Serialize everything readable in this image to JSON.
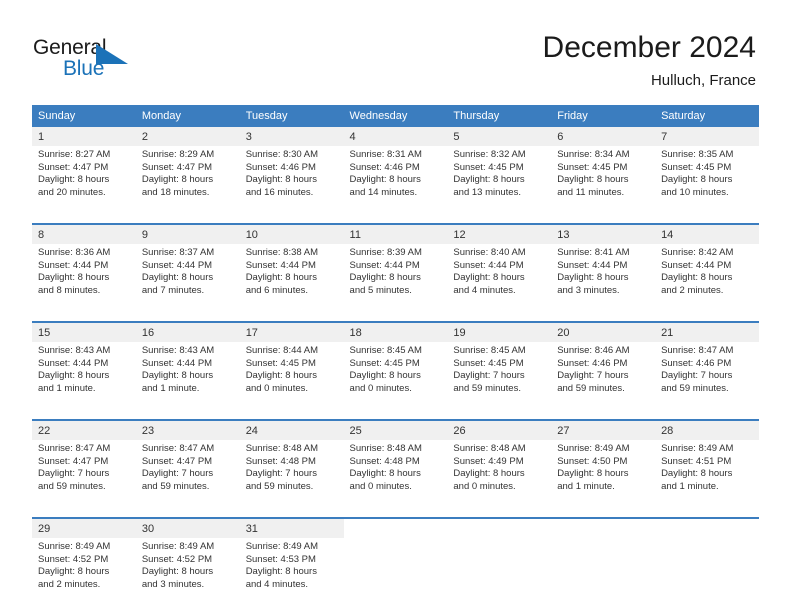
{
  "brand": {
    "name_part1": "General",
    "name_part2": "Blue",
    "accent_color": "#1b72b8"
  },
  "header": {
    "title": "December 2024",
    "subtitle": "Hulluch, France"
  },
  "theme": {
    "header_bg": "#3b7dbf",
    "daynum_bg": "#f0f0f0",
    "text": "#333333"
  },
  "weekdays": [
    "Sunday",
    "Monday",
    "Tuesday",
    "Wednesday",
    "Thursday",
    "Friday",
    "Saturday"
  ],
  "weeks": [
    [
      {
        "day": "1",
        "sunrise": "Sunrise: 8:27 AM",
        "sunset": "Sunset: 4:47 PM",
        "daylight1": "Daylight: 8 hours",
        "daylight2": "and 20 minutes."
      },
      {
        "day": "2",
        "sunrise": "Sunrise: 8:29 AM",
        "sunset": "Sunset: 4:47 PM",
        "daylight1": "Daylight: 8 hours",
        "daylight2": "and 18 minutes."
      },
      {
        "day": "3",
        "sunrise": "Sunrise: 8:30 AM",
        "sunset": "Sunset: 4:46 PM",
        "daylight1": "Daylight: 8 hours",
        "daylight2": "and 16 minutes."
      },
      {
        "day": "4",
        "sunrise": "Sunrise: 8:31 AM",
        "sunset": "Sunset: 4:46 PM",
        "daylight1": "Daylight: 8 hours",
        "daylight2": "and 14 minutes."
      },
      {
        "day": "5",
        "sunrise": "Sunrise: 8:32 AM",
        "sunset": "Sunset: 4:45 PM",
        "daylight1": "Daylight: 8 hours",
        "daylight2": "and 13 minutes."
      },
      {
        "day": "6",
        "sunrise": "Sunrise: 8:34 AM",
        "sunset": "Sunset: 4:45 PM",
        "daylight1": "Daylight: 8 hours",
        "daylight2": "and 11 minutes."
      },
      {
        "day": "7",
        "sunrise": "Sunrise: 8:35 AM",
        "sunset": "Sunset: 4:45 PM",
        "daylight1": "Daylight: 8 hours",
        "daylight2": "and 10 minutes."
      }
    ],
    [
      {
        "day": "8",
        "sunrise": "Sunrise: 8:36 AM",
        "sunset": "Sunset: 4:44 PM",
        "daylight1": "Daylight: 8 hours",
        "daylight2": "and 8 minutes."
      },
      {
        "day": "9",
        "sunrise": "Sunrise: 8:37 AM",
        "sunset": "Sunset: 4:44 PM",
        "daylight1": "Daylight: 8 hours",
        "daylight2": "and 7 minutes."
      },
      {
        "day": "10",
        "sunrise": "Sunrise: 8:38 AM",
        "sunset": "Sunset: 4:44 PM",
        "daylight1": "Daylight: 8 hours",
        "daylight2": "and 6 minutes."
      },
      {
        "day": "11",
        "sunrise": "Sunrise: 8:39 AM",
        "sunset": "Sunset: 4:44 PM",
        "daylight1": "Daylight: 8 hours",
        "daylight2": "and 5 minutes."
      },
      {
        "day": "12",
        "sunrise": "Sunrise: 8:40 AM",
        "sunset": "Sunset: 4:44 PM",
        "daylight1": "Daylight: 8 hours",
        "daylight2": "and 4 minutes."
      },
      {
        "day": "13",
        "sunrise": "Sunrise: 8:41 AM",
        "sunset": "Sunset: 4:44 PM",
        "daylight1": "Daylight: 8 hours",
        "daylight2": "and 3 minutes."
      },
      {
        "day": "14",
        "sunrise": "Sunrise: 8:42 AM",
        "sunset": "Sunset: 4:44 PM",
        "daylight1": "Daylight: 8 hours",
        "daylight2": "and 2 minutes."
      }
    ],
    [
      {
        "day": "15",
        "sunrise": "Sunrise: 8:43 AM",
        "sunset": "Sunset: 4:44 PM",
        "daylight1": "Daylight: 8 hours",
        "daylight2": "and 1 minute."
      },
      {
        "day": "16",
        "sunrise": "Sunrise: 8:43 AM",
        "sunset": "Sunset: 4:44 PM",
        "daylight1": "Daylight: 8 hours",
        "daylight2": "and 1 minute."
      },
      {
        "day": "17",
        "sunrise": "Sunrise: 8:44 AM",
        "sunset": "Sunset: 4:45 PM",
        "daylight1": "Daylight: 8 hours",
        "daylight2": "and 0 minutes."
      },
      {
        "day": "18",
        "sunrise": "Sunrise: 8:45 AM",
        "sunset": "Sunset: 4:45 PM",
        "daylight1": "Daylight: 8 hours",
        "daylight2": "and 0 minutes."
      },
      {
        "day": "19",
        "sunrise": "Sunrise: 8:45 AM",
        "sunset": "Sunset: 4:45 PM",
        "daylight1": "Daylight: 7 hours",
        "daylight2": "and 59 minutes."
      },
      {
        "day": "20",
        "sunrise": "Sunrise: 8:46 AM",
        "sunset": "Sunset: 4:46 PM",
        "daylight1": "Daylight: 7 hours",
        "daylight2": "and 59 minutes."
      },
      {
        "day": "21",
        "sunrise": "Sunrise: 8:47 AM",
        "sunset": "Sunset: 4:46 PM",
        "daylight1": "Daylight: 7 hours",
        "daylight2": "and 59 minutes."
      }
    ],
    [
      {
        "day": "22",
        "sunrise": "Sunrise: 8:47 AM",
        "sunset": "Sunset: 4:47 PM",
        "daylight1": "Daylight: 7 hours",
        "daylight2": "and 59 minutes."
      },
      {
        "day": "23",
        "sunrise": "Sunrise: 8:47 AM",
        "sunset": "Sunset: 4:47 PM",
        "daylight1": "Daylight: 7 hours",
        "daylight2": "and 59 minutes."
      },
      {
        "day": "24",
        "sunrise": "Sunrise: 8:48 AM",
        "sunset": "Sunset: 4:48 PM",
        "daylight1": "Daylight: 7 hours",
        "daylight2": "and 59 minutes."
      },
      {
        "day": "25",
        "sunrise": "Sunrise: 8:48 AM",
        "sunset": "Sunset: 4:48 PM",
        "daylight1": "Daylight: 8 hours",
        "daylight2": "and 0 minutes."
      },
      {
        "day": "26",
        "sunrise": "Sunrise: 8:48 AM",
        "sunset": "Sunset: 4:49 PM",
        "daylight1": "Daylight: 8 hours",
        "daylight2": "and 0 minutes."
      },
      {
        "day": "27",
        "sunrise": "Sunrise: 8:49 AM",
        "sunset": "Sunset: 4:50 PM",
        "daylight1": "Daylight: 8 hours",
        "daylight2": "and 1 minute."
      },
      {
        "day": "28",
        "sunrise": "Sunrise: 8:49 AM",
        "sunset": "Sunset: 4:51 PM",
        "daylight1": "Daylight: 8 hours",
        "daylight2": "and 1 minute."
      }
    ],
    [
      {
        "day": "29",
        "sunrise": "Sunrise: 8:49 AM",
        "sunset": "Sunset: 4:52 PM",
        "daylight1": "Daylight: 8 hours",
        "daylight2": "and 2 minutes."
      },
      {
        "day": "30",
        "sunrise": "Sunrise: 8:49 AM",
        "sunset": "Sunset: 4:52 PM",
        "daylight1": "Daylight: 8 hours",
        "daylight2": "and 3 minutes."
      },
      {
        "day": "31",
        "sunrise": "Sunrise: 8:49 AM",
        "sunset": "Sunset: 4:53 PM",
        "daylight1": "Daylight: 8 hours",
        "daylight2": "and 4 minutes."
      },
      {
        "day": "",
        "sunrise": "",
        "sunset": "",
        "daylight1": "",
        "daylight2": ""
      },
      {
        "day": "",
        "sunrise": "",
        "sunset": "",
        "daylight1": "",
        "daylight2": ""
      },
      {
        "day": "",
        "sunrise": "",
        "sunset": "",
        "daylight1": "",
        "daylight2": ""
      },
      {
        "day": "",
        "sunrise": "",
        "sunset": "",
        "daylight1": "",
        "daylight2": ""
      }
    ]
  ]
}
